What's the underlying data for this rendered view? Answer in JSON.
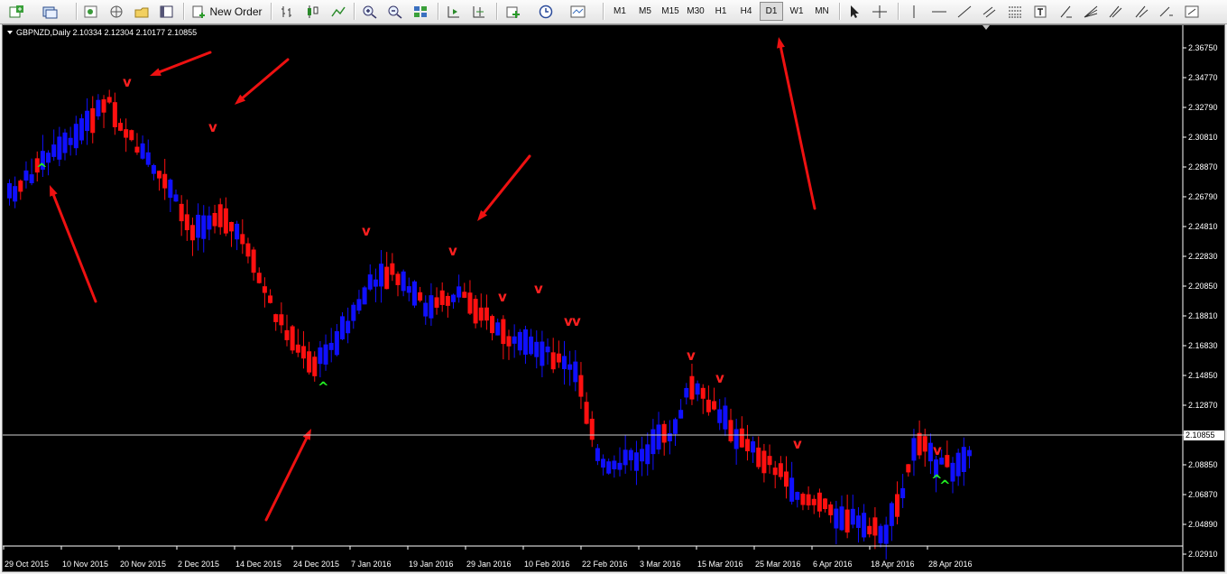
{
  "toolbar": {
    "new_order_label": "New Order",
    "timeframes": [
      "M1",
      "M5",
      "M15",
      "M30",
      "H1",
      "H4",
      "D1",
      "W1",
      "MN"
    ],
    "active_timeframe": "D1"
  },
  "chart": {
    "header": "GBPNZD,Daily  2.10334 2.12304 2.10177 2.10855",
    "current_price": "2.10855",
    "price_labels": [
      "2.36750",
      "2.34770",
      "2.32790",
      "2.30810",
      "2.28870",
      "2.26790",
      "2.24810",
      "2.22830",
      "2.20850",
      "2.18810",
      "2.16830",
      "2.14850",
      "2.12870",
      "2.10855",
      "2.08850",
      "2.06870",
      "2.04890",
      "2.02910"
    ],
    "date_labels": [
      "29 Oct 2015",
      "10 Nov 2015",
      "20 Nov 2015",
      "2 Dec 2015",
      "14 Dec 2015",
      "24 Dec 2015",
      "7 Jan 2016",
      "19 Jan 2016",
      "29 Jan 2016",
      "10 Feb 2016",
      "22 Feb 2016",
      "3 Mar 2016",
      "15 Mar 2016",
      "25 Mar 2016",
      "6 Apr 2016",
      "18 Apr 2016",
      "28 Apr 2016"
    ],
    "colors": {
      "bull": "#1010ff",
      "bear": "#ff1010",
      "bg": "#000000",
      "grid_text": "#ffffff",
      "arrow": "#ee1111",
      "up_signal": "#22ee22",
      "down_signal": "#ff2020"
    }
  }
}
